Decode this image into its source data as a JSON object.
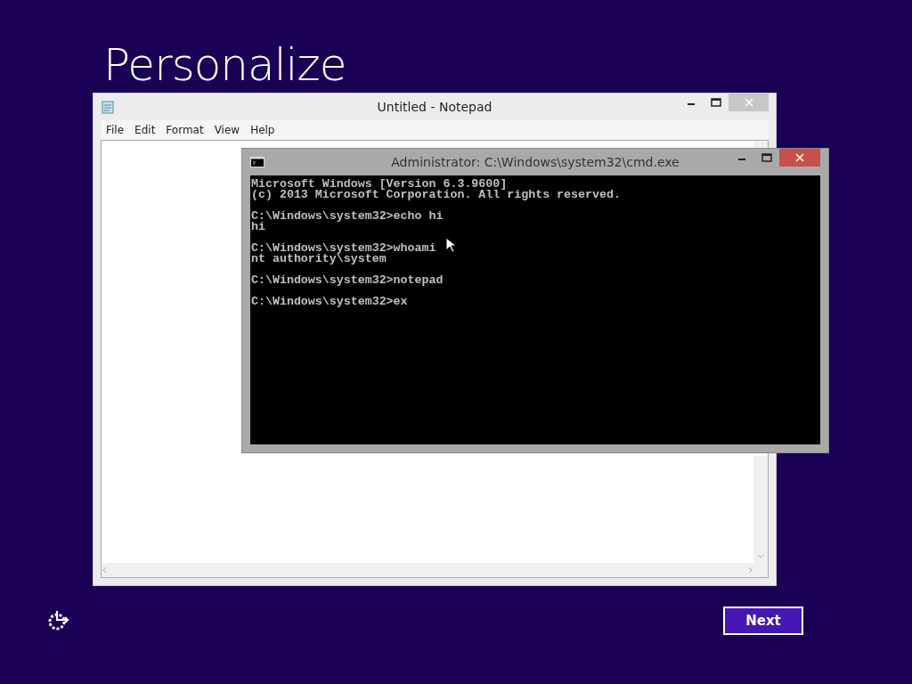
{
  "page_title": "Personalize",
  "notepad": {
    "title": "Untitled - Notepad",
    "menu": [
      "File",
      "Edit",
      "Format",
      "View",
      "Help"
    ]
  },
  "cmd": {
    "title": "Administrator: C:\\Windows\\system32\\cmd.exe",
    "blocks": [
      [
        "Microsoft Windows [Version 6.3.9600]",
        "(c) 2013 Microsoft Corporation. All rights reserved."
      ],
      [
        "C:\\Windows\\system32>echo hi",
        "hi"
      ],
      [
        "C:\\Windows\\system32>whoami",
        "nt authority\\system"
      ],
      [
        "C:\\Windows\\system32>notepad"
      ],
      [
        "C:\\Windows\\system32>ex"
      ]
    ]
  },
  "next_button": "Next"
}
